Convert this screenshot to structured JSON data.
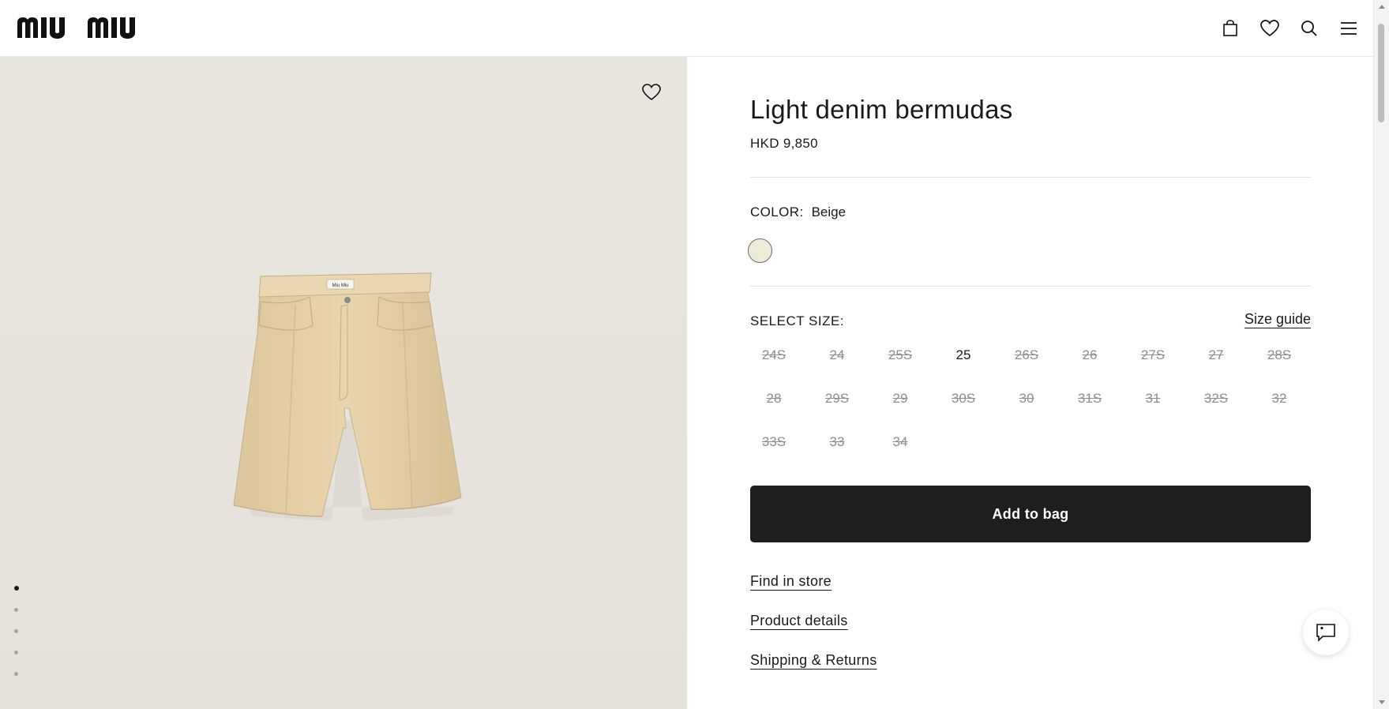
{
  "brand": {
    "logo_text": "miu miu"
  },
  "header": {
    "icons": [
      {
        "name": "bag-icon"
      },
      {
        "name": "wishlist-icon"
      },
      {
        "name": "search-icon"
      },
      {
        "name": "menu-icon"
      }
    ]
  },
  "product": {
    "title": "Light denim bermudas",
    "price": "HKD 9,850",
    "color_label": "COLOR:",
    "color_value": "Beige",
    "swatch_color": "#ecebd7",
    "size_label": "SELECT SIZE:",
    "size_guide_label": "Size guide",
    "sizes": [
      {
        "label": "24S",
        "available": false
      },
      {
        "label": "24",
        "available": false
      },
      {
        "label": "25S",
        "available": false
      },
      {
        "label": "25",
        "available": true
      },
      {
        "label": "26S",
        "available": false
      },
      {
        "label": "26",
        "available": false
      },
      {
        "label": "27S",
        "available": false
      },
      {
        "label": "27",
        "available": false
      },
      {
        "label": "28S",
        "available": false
      },
      {
        "label": "28",
        "available": false
      },
      {
        "label": "29S",
        "available": false
      },
      {
        "label": "29",
        "available": false
      },
      {
        "label": "30S",
        "available": false
      },
      {
        "label": "30",
        "available": false
      },
      {
        "label": "31S",
        "available": false
      },
      {
        "label": "31",
        "available": false
      },
      {
        "label": "32S",
        "available": false
      },
      {
        "label": "32",
        "available": false
      },
      {
        "label": "33S",
        "available": false
      },
      {
        "label": "33",
        "available": false
      },
      {
        "label": "34",
        "available": false
      }
    ],
    "add_to_bag_label": "Add to bag",
    "links": {
      "find_in_store": "Find in store",
      "product_details": "Product details",
      "shipping_returns": "Shipping & Returns"
    }
  },
  "gallery": {
    "image_count": 5,
    "active_index": 0
  },
  "colors": {
    "button_bg": "#1d1e20",
    "image_bg": "#e8e4dd",
    "garment": "#e3cfa7"
  }
}
